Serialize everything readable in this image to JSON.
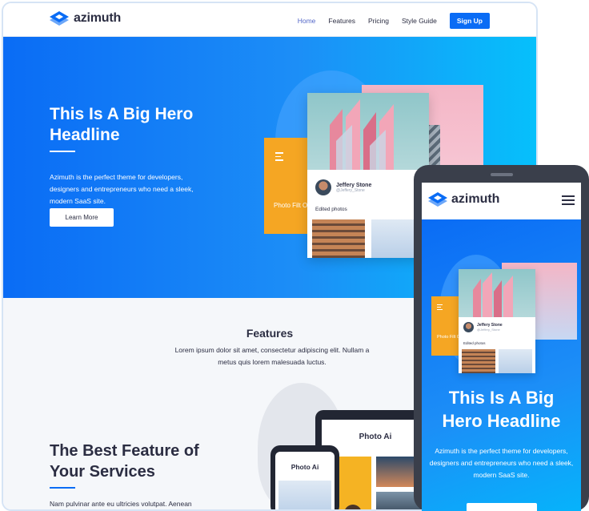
{
  "desktop": {
    "nav": {
      "logo": "azimuth",
      "links": [
        "Home",
        "Features",
        "Pricing",
        "Style Guide"
      ],
      "cta": "Sign Up"
    },
    "hero": {
      "title": "This Is A Big Hero Headline",
      "text": "Azimuth is the perfect theme for developers, designers and entrepreneurs who need a sleek, modern SaaS site.",
      "button": "Learn More",
      "card": {
        "orange_text": "Photo Filt Orange",
        "user_name": "Jeffery Stone",
        "user_handle": "@Jeffery_Stone",
        "label": "Edited photos"
      }
    },
    "features": {
      "title": "Features",
      "text": "Lorem ipsum dolor sit amet, consectetur adipiscing elit. Nullam a metus quis lorem malesuada luctus.",
      "best_title": "The Best Feature of Your Services",
      "best_text": "Nam pulvinar ante eu ultricies volutpat. Aenean",
      "device_title": "Photo Ai"
    }
  },
  "mobile": {
    "logo": "azimuth",
    "hero_title": "This Is A Big Hero Headline",
    "hero_text": "Azimuth is the perfect theme for developers, designers and entrepreneurs who need a sleek, modern SaaS site.",
    "card": {
      "orange_text": "Photo Filt Orange",
      "user_name": "Jeffery Stone",
      "user_handle": "@Jeffery_Stone",
      "label": "Edited photos"
    }
  },
  "icons": [
    "azimuth-logo-icon",
    "hamburger-menu-icon",
    "filter-lines-icon"
  ],
  "colors": {
    "primary": "#0a6cf5",
    "accent_orange": "#f5a623",
    "accent_pink": "#f4b6c6",
    "text": "#2b2d42"
  }
}
